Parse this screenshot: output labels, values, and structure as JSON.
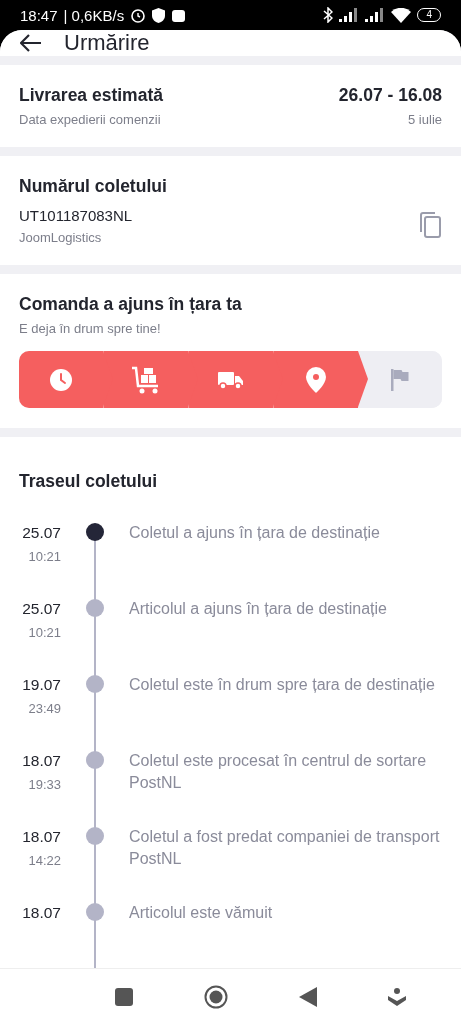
{
  "status_bar": {
    "time": "18:47",
    "speed": "| 0,6KB/s",
    "battery": "4"
  },
  "header": {
    "title": "Urmărire"
  },
  "delivery": {
    "title": "Livrarea estimată",
    "subtitle": "Data expedierii comenzii",
    "range": "26.07 - 16.08",
    "ship_date": "5 iulie"
  },
  "parcel": {
    "title": "Numărul coletului",
    "number": "UT101187083NL",
    "carrier": "JoomLogistics"
  },
  "status": {
    "title": "Comanda a ajuns în țara ta",
    "subtitle": "E deja în drum spre tine!",
    "stages": [
      {
        "kind": "clock",
        "done": true
      },
      {
        "kind": "cart",
        "done": true
      },
      {
        "kind": "truck",
        "done": true
      },
      {
        "kind": "pin",
        "done": true
      },
      {
        "kind": "flag",
        "done": false
      }
    ]
  },
  "route": {
    "title": "Traseul coletului",
    "events": [
      {
        "date": "25.07",
        "time": "10:21",
        "text": "Coletul a ajuns în țara de destinație",
        "current": true
      },
      {
        "date": "25.07",
        "time": "10:21",
        "text": "Articolul a ajuns în țara de destinație",
        "current": false
      },
      {
        "date": "19.07",
        "time": "23:49",
        "text": "Coletul este în drum spre țara de destinație",
        "current": false
      },
      {
        "date": "18.07",
        "time": "19:33",
        "text": "Coletul este procesat în centrul de sortare PostNL",
        "current": false
      },
      {
        "date": "18.07",
        "time": "14:22",
        "text": "Coletul a fost predat companiei de transport PostNL",
        "current": false
      },
      {
        "date": "18.07",
        "text": "Articolul este vămuit",
        "current": false
      }
    ]
  }
}
